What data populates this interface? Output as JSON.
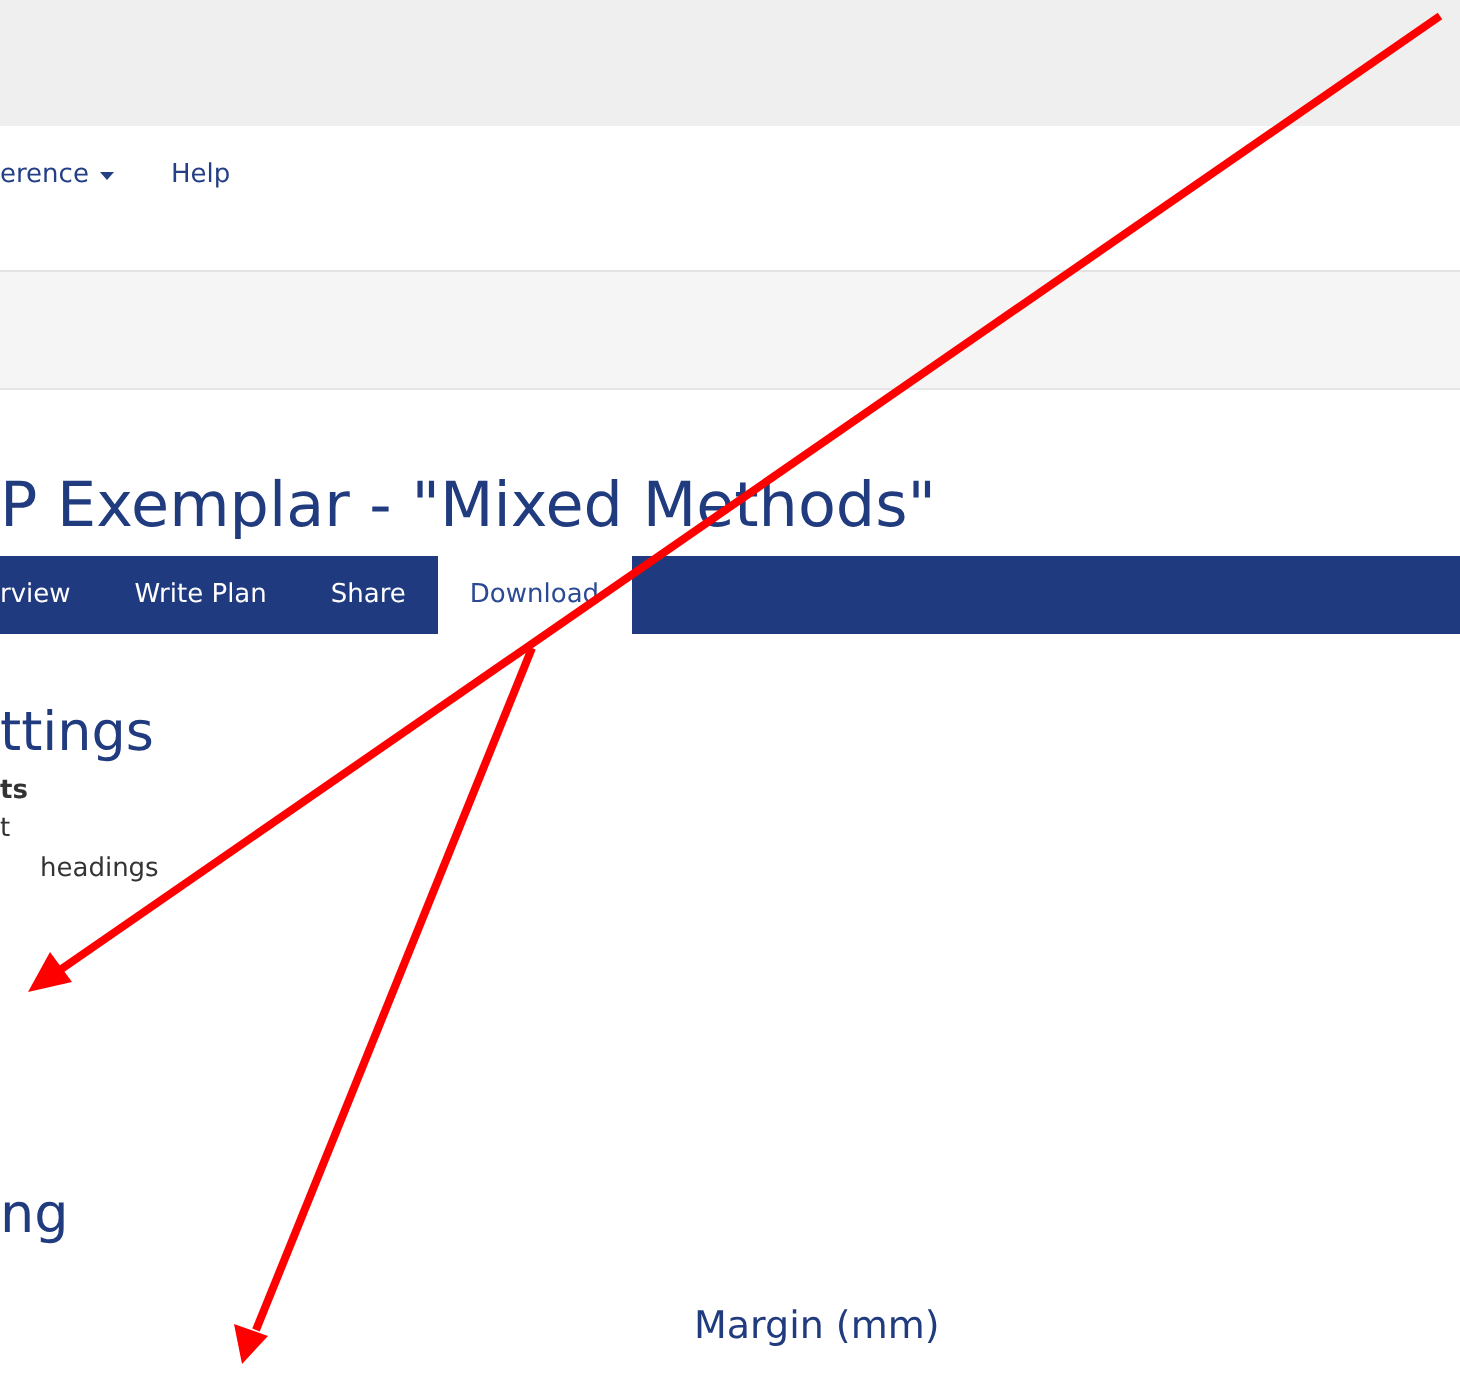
{
  "nav": {
    "items": [
      {
        "label": "erence",
        "kind": "dropdown"
      },
      {
        "label": "Help",
        "kind": "link"
      }
    ]
  },
  "page_title": "P Exemplar - \"Mixed Methods\"",
  "tabs": [
    {
      "label": "rview",
      "selected": false
    },
    {
      "label": "Write Plan",
      "selected": false
    },
    {
      "label": "Share",
      "selected": false
    },
    {
      "label": "Download",
      "selected": true
    }
  ],
  "settings": {
    "heading": "ttings",
    "subheading": "ts",
    "options": [
      "t",
      "headings"
    ]
  },
  "formatting": {
    "heading": "ng",
    "margin_label": "Margin (mm)"
  }
}
